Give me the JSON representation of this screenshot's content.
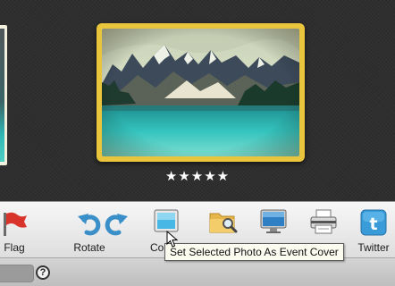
{
  "viewer": {
    "rating": "★★★★★"
  },
  "toolbar": {
    "items": [
      {
        "label": "Flag",
        "icon": "flag-icon"
      },
      {
        "label": "Rotate",
        "icon": "rotate-left-icon"
      },
      {
        "label": "",
        "icon": "rotate-right-icon"
      },
      {
        "label": "Co",
        "icon": "cover-icon"
      },
      {
        "label": "",
        "icon": "folder-search-icon"
      },
      {
        "label": "",
        "icon": "monitor-icon"
      },
      {
        "label": "",
        "icon": "printer-icon"
      },
      {
        "label": "Twitter",
        "icon": "twitter-icon"
      }
    ]
  },
  "tooltip": {
    "text": "Set Selected Photo As Event Cover"
  },
  "statusbar": {
    "help_label": "?"
  },
  "colors": {
    "frame_gold": "#e9c53e",
    "toolbar_blue": "#3a8fc9"
  }
}
